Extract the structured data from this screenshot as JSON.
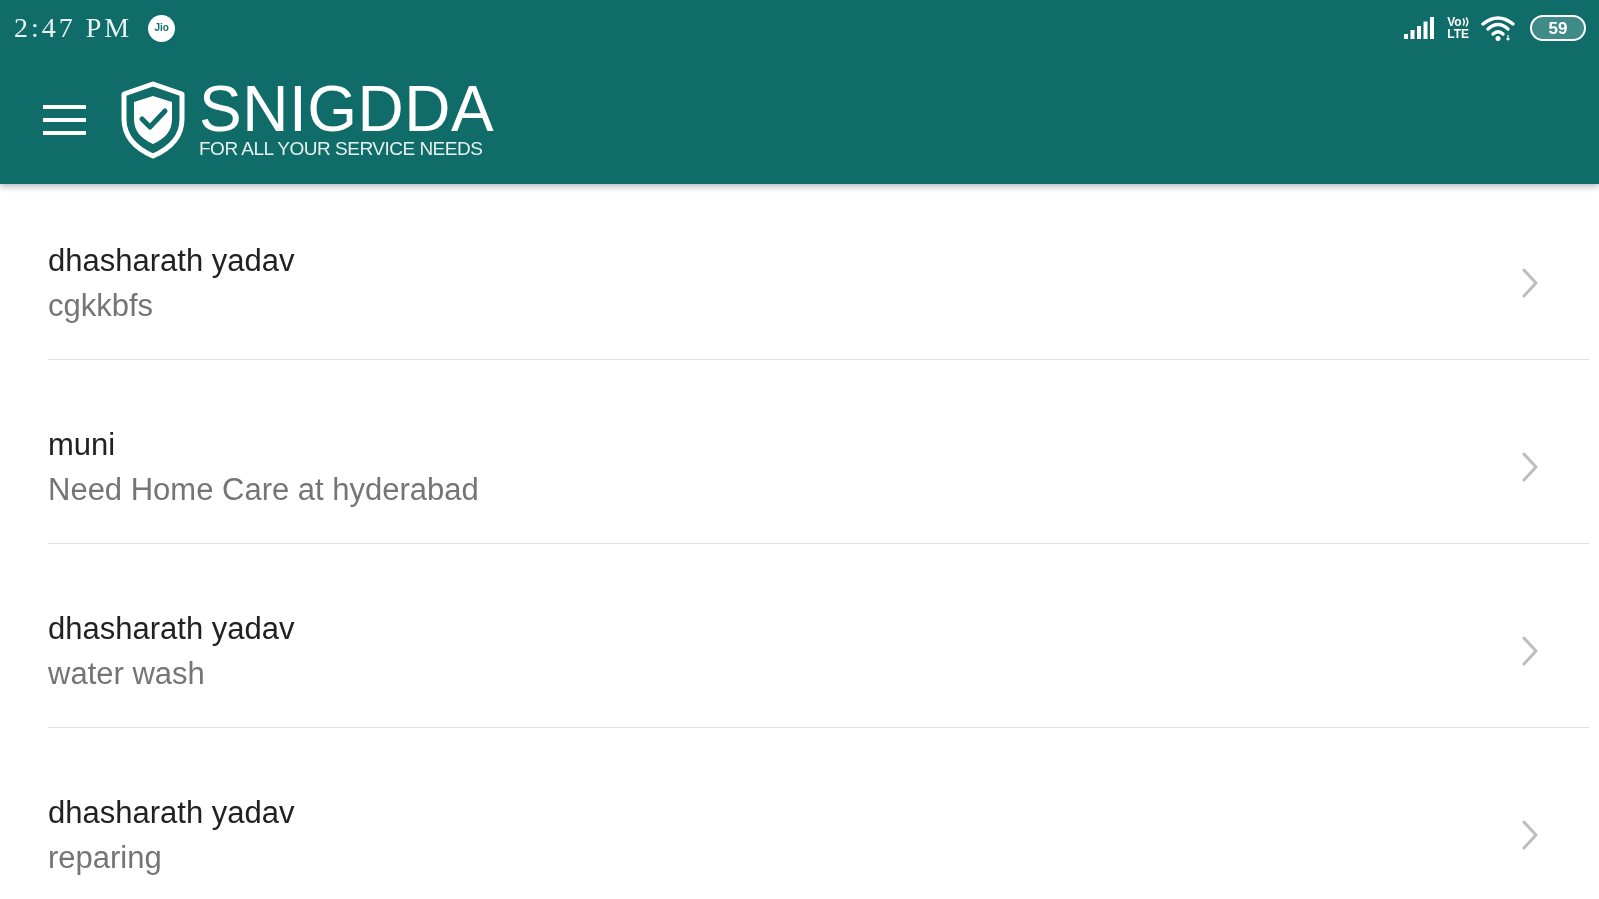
{
  "status_bar": {
    "time": "2:47 PM",
    "carrier_badge": "Jio",
    "volte": {
      "line_1": "Vo",
      "line_2": "LTE"
    },
    "battery": "59"
  },
  "app_bar": {
    "logo": {
      "name": "SNIGDDA",
      "tagline": "FOR ALL YOUR SERVICE NEEDS"
    }
  },
  "list": {
    "items": [
      {
        "title": "dhasharath yadav",
        "subtitle": "cgkkbfs"
      },
      {
        "title": "muni",
        "subtitle": "Need Home Care at hyderabad"
      },
      {
        "title": "dhasharath yadav",
        "subtitle": "water wash"
      },
      {
        "title": "dhasharath yadav",
        "subtitle": "reparing"
      }
    ]
  }
}
